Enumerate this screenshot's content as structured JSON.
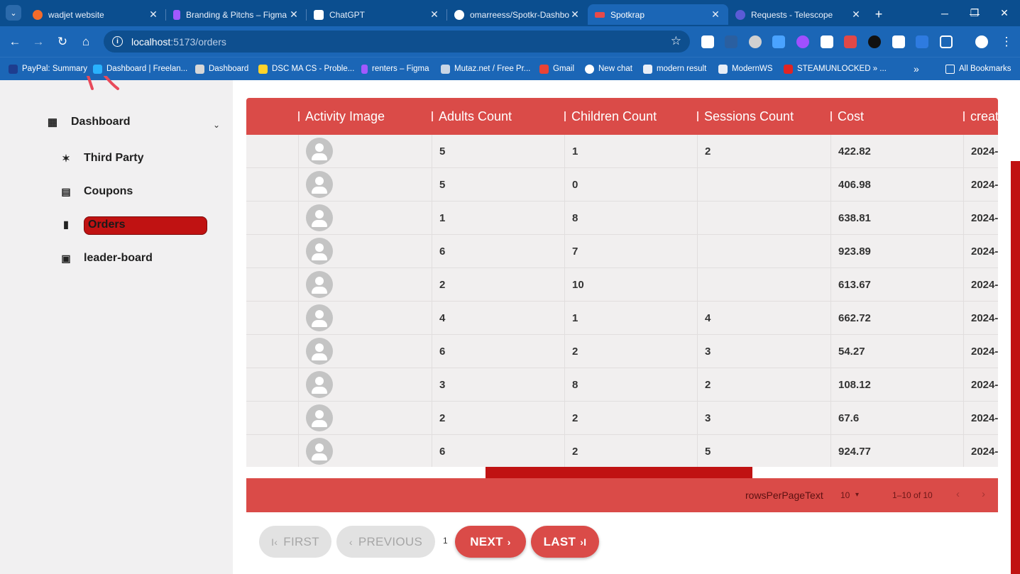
{
  "browser": {
    "tabs": [
      {
        "title": "wadjet website",
        "color": "#f36b2b"
      },
      {
        "title": "Branding & Pitchs – Figma",
        "color": "#a259ff"
      },
      {
        "title": "ChatGPT",
        "color": "#ffffff"
      },
      {
        "title": "omarreess/Spotkr-Dashbo",
        "color": "#ffffff"
      },
      {
        "title": "Spotkrap",
        "color": "#e84a4a"
      },
      {
        "title": "Requests - Telescope",
        "color": "#5b5bd6"
      }
    ],
    "url_host": "localhost",
    "url_path": ":5173/orders",
    "bookmarks": [
      "PayPal: Summary",
      "Dashboard | Freelan...",
      "Dashboard",
      "DSC MA CS - Proble...",
      "renters – Figma",
      "Mutaz.net / Free Pr...",
      "Gmail",
      "New chat",
      "modern result",
      "ModernWS",
      "STEAMUNLOCKED » ..."
    ],
    "all_bookmarks": "All Bookmarks"
  },
  "sidebar": {
    "dashboard": "Dashboard",
    "third_party": "Third Party",
    "coupons": "Coupons",
    "orders": "Orders",
    "leaderboard": "leader-board"
  },
  "table": {
    "columns": [
      "Activity Image",
      "Adults Count",
      "Children Count",
      "Sessions Count",
      "Cost",
      "creat"
    ],
    "rows": [
      {
        "adults": "5",
        "children": "1",
        "sessions": "2",
        "cost": "422.82",
        "created": "2024-"
      },
      {
        "adults": "5",
        "children": "0",
        "sessions": "",
        "cost": "406.98",
        "created": "2024-"
      },
      {
        "adults": "1",
        "children": "8",
        "sessions": "",
        "cost": "638.81",
        "created": "2024-"
      },
      {
        "adults": "6",
        "children": "7",
        "sessions": "",
        "cost": "923.89",
        "created": "2024-"
      },
      {
        "adults": "2",
        "children": "10",
        "sessions": "",
        "cost": "613.67",
        "created": "2024-"
      },
      {
        "adults": "4",
        "children": "1",
        "sessions": "4",
        "cost": "662.72",
        "created": "2024-"
      },
      {
        "adults": "6",
        "children": "2",
        "sessions": "3",
        "cost": "54.27",
        "created": "2024-"
      },
      {
        "adults": "3",
        "children": "8",
        "sessions": "2",
        "cost": "108.12",
        "created": "2024-"
      },
      {
        "adults": "2",
        "children": "2",
        "sessions": "3",
        "cost": "67.6",
        "created": "2024-"
      },
      {
        "adults": "6",
        "children": "2",
        "sessions": "5",
        "cost": "924.77",
        "created": "2024-"
      }
    ]
  },
  "table_footer": {
    "rows_per_page_label": "rowsPerPageText",
    "rows_per_page_value": "10",
    "range": "1–10 of 10"
  },
  "pagination": {
    "first": "FIRST",
    "previous": "PREVIOUS",
    "page": "1",
    "next": "NEXT",
    "last": "LAST"
  },
  "colors": {
    "header_red": "#da4b48",
    "accent_red": "#c01212",
    "browser_blue": "#1b66b6"
  }
}
